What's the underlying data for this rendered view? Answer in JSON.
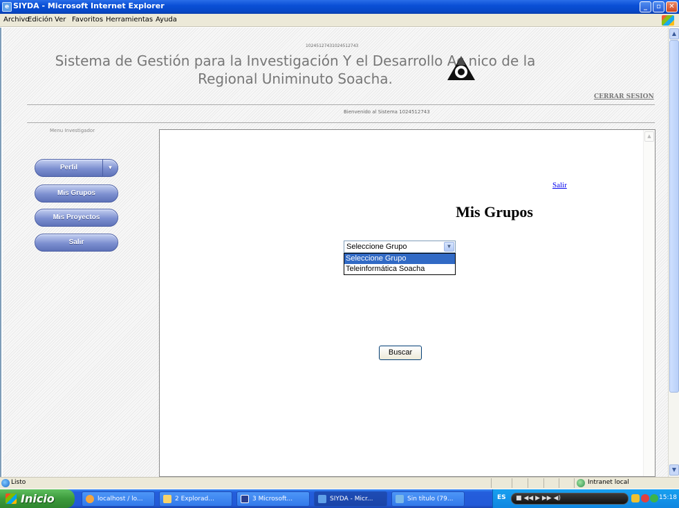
{
  "window": {
    "title": "SIYDA - Microsoft Internet Explorer"
  },
  "menubar": {
    "items": [
      "Archivo",
      "Edición",
      "Ver",
      "Favoritos",
      "Herramientas",
      "Ayuda"
    ]
  },
  "site": {
    "id_text": "10245127431024512743",
    "title": "Sistema de Gestión para la Investigación Y el Desarrollo Ac nico de la Regional Uniminuto Soacha.",
    "logout": "CERRAR SESION",
    "welcome": "Bienvenido al Sistema 1024512743",
    "menu_label": "Menu Investigador",
    "nav": [
      {
        "label": "Perfil",
        "has_dropdown": true
      },
      {
        "label": "Mis Grupos"
      },
      {
        "label": "Mis Proyectos"
      },
      {
        "label": "Salir"
      }
    ]
  },
  "content": {
    "salir_link": "Salir",
    "heading": "Mis Grupos",
    "select": {
      "value": "Seleccione Grupo",
      "options": [
        "Seleccione Grupo",
        "Teleinformática Soacha"
      ],
      "highlighted": "Seleccione Grupo"
    },
    "search_button": "Buscar"
  },
  "statusbar": {
    "status": "Listo",
    "zone": "Intranet local"
  },
  "taskbar": {
    "start": "Inicio",
    "tasks": [
      "localhost / lo...",
      "2 Explorad...",
      "3 Microsoft...",
      "SIYDA - Micr...",
      "Sin título (79..."
    ],
    "language": "ES",
    "clock": "15:18"
  },
  "colors": {
    "titlebar": "#0a4fd6",
    "nav_button": "#7c8fd0",
    "selection": "#316ac5",
    "link": "#0000ee"
  }
}
